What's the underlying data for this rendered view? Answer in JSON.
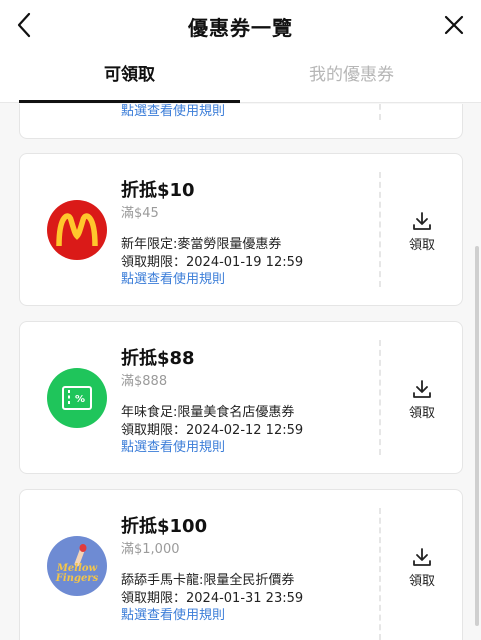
{
  "header": {
    "title": "優惠券一覽"
  },
  "tabs": [
    {
      "label": "可領取",
      "active": true
    },
    {
      "label": "我的優惠券",
      "active": false
    }
  ],
  "coupons": [
    {
      "rules": "點選查看使用規則"
    },
    {
      "amount": "折抵$10",
      "min_spend": "滿$45",
      "description": "新年限定:麥當勞限量優惠券",
      "period": "領取期限：2024-01-19 12:59",
      "rules": "點選查看使用規則",
      "claim": "領取",
      "logo_icon": "mcdonalds-logo-icon"
    },
    {
      "amount": "折抵$88",
      "min_spend": "滿$888",
      "description": "年味食足:限量美食名店優惠券",
      "period": "領取期限：2024-02-12 12:59",
      "rules": "點選查看使用規則",
      "claim": "領取",
      "logo_icon": "coupon-ticket-icon"
    },
    {
      "amount": "折抵$100",
      "min_spend": "滿$1,000",
      "description": "舔舔手馬卡龍:限量全民折價券",
      "period": "領取期限：2024-01-31 23:59",
      "rules": "點選查看使用規則",
      "claim": "領取",
      "logo_icon": "macaron-shop-logo-icon",
      "logo_text": "Mellow Fingers"
    }
  ],
  "colors": {
    "link": "#3b7dd8",
    "mcdonalds_red": "#da1a18",
    "mcdonalds_yellow": "#ffc72c",
    "green": "#1fc55b",
    "macaron_blue": "#6e8bd3"
  }
}
